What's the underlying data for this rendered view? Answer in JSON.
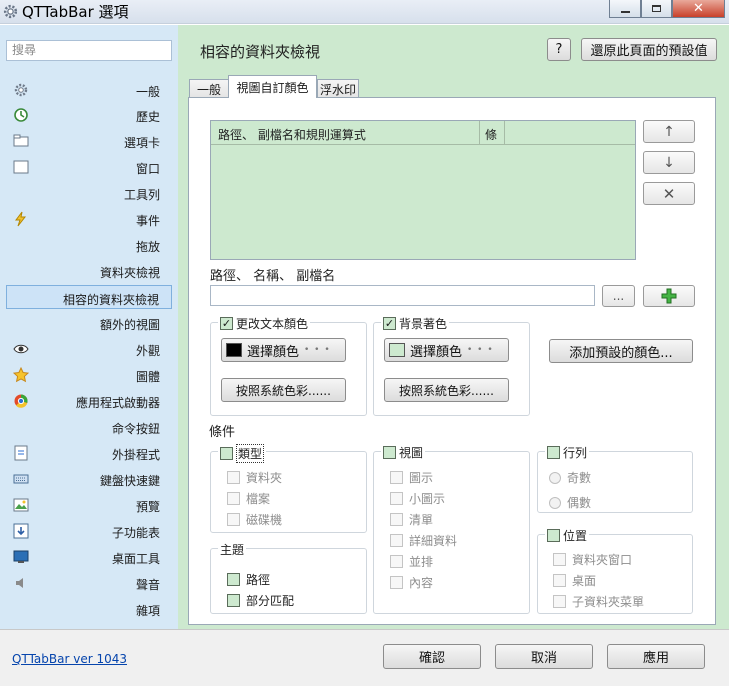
{
  "window": {
    "title": "QTTabBar 選項"
  },
  "sidebar": {
    "search_placeholder": "搜尋",
    "items": [
      {
        "label": "一般",
        "icon": "gear-icon"
      },
      {
        "label": "歷史",
        "icon": "history-icon"
      },
      {
        "label": "選項卡",
        "icon": "tab-icon"
      },
      {
        "label": "窗口",
        "icon": "window-icon"
      },
      {
        "label": "工具列",
        "icon": ""
      },
      {
        "label": "事件",
        "icon": "lightning-icon"
      },
      {
        "label": "拖放",
        "icon": ""
      },
      {
        "label": "資料夾檢視",
        "icon": ""
      },
      {
        "label": "相容的資料夾檢視",
        "icon": ""
      },
      {
        "label": "額外的視圖",
        "icon": ""
      },
      {
        "label": "外觀",
        "icon": "eye-icon"
      },
      {
        "label": "圖體",
        "icon": "star-icon"
      },
      {
        "label": "應用程式啟動器",
        "icon": "app-launcher-icon"
      },
      {
        "label": "命令按鈕",
        "icon": ""
      },
      {
        "label": "外掛程式",
        "icon": "plugin-icon"
      },
      {
        "label": "鍵盤快速鍵",
        "icon": "keyboard-icon"
      },
      {
        "label": "預覽",
        "icon": "preview-icon"
      },
      {
        "label": "子功能表",
        "icon": "submenu-icon"
      },
      {
        "label": "桌面工具",
        "icon": "desktop-icon"
      },
      {
        "label": "聲音",
        "icon": "speaker-icon"
      },
      {
        "label": "雜項",
        "icon": ""
      }
    ],
    "selected_index": 8
  },
  "header": {
    "title": "相容的資料夾檢視",
    "help_label": "?",
    "restore_label": "還原此頁面的預設值"
  },
  "tabs": [
    {
      "label": "一般"
    },
    {
      "label": "視圖自訂顏色"
    },
    {
      "label": "浮水印"
    }
  ],
  "active_tab": 1,
  "list": {
    "columns": [
      "路徑、 副檔名和規則運算式",
      "條"
    ]
  },
  "side_buttons": {
    "up": "↑",
    "down": "↓",
    "delete": "✕"
  },
  "path_label": "路徑、 名稱、 副檔名",
  "path_input": {
    "value": ""
  },
  "browse_label": "...",
  "add_label": "+",
  "text_color_group": {
    "label": "更改文本顏色",
    "checked": true,
    "swatch": "#000000",
    "choose_label": "選擇顏色",
    "dots": "• • •",
    "system_label": "按照系統色彩......"
  },
  "bg_color_group": {
    "label": "背景著色",
    "checked": true,
    "swatch": "#cde9cf",
    "choose_label": "選擇顏色",
    "dots": "• • •",
    "system_label": "按照系統色彩......"
  },
  "add_preset_label": "添加預設的顏色...",
  "conditions": {
    "label": "條件",
    "type_group": {
      "label": "類型",
      "items": [
        "資料夾",
        "檔案",
        "磁碟機"
      ]
    },
    "view_group": {
      "label": "視圖",
      "items": [
        "圖示",
        "小圖示",
        "清單",
        "詳細資料",
        "並排",
        "內容"
      ]
    },
    "row_group": {
      "label": "行列",
      "items": [
        "奇數",
        "偶數"
      ]
    },
    "subject_group": {
      "label": "主題",
      "items": [
        "路徑",
        "部分匹配"
      ]
    },
    "location_group": {
      "label": "位置",
      "items": [
        "資料夾窗口",
        "桌面",
        "子資料夾菜單"
      ]
    }
  },
  "footer": {
    "version": "QTTabBar ver 1043",
    "ok_label": "確認",
    "cancel_label": "取消",
    "apply_label": "應用"
  },
  "colors": {
    "accent_green": "#cde9cf",
    "sidebar_bg": "#d6e8f6",
    "add_green": "#3aa63a"
  }
}
